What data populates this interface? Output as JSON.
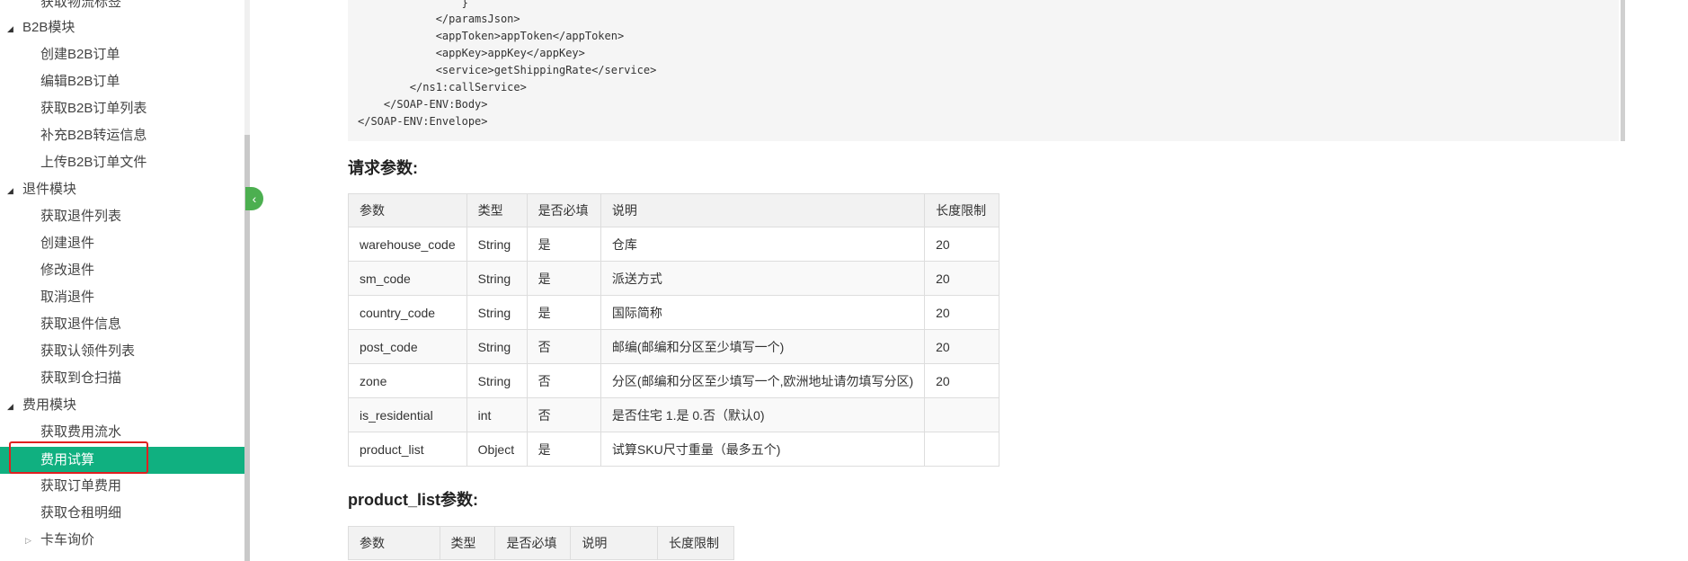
{
  "sidebar": {
    "truncated_top": "获取物流标签",
    "groups": {
      "b2b": {
        "label": "B2B模块",
        "items": [
          "创建B2B订单",
          "编辑B2B订单",
          "获取B2B订单列表",
          "补充B2B转运信息",
          "上传B2B订单文件"
        ]
      },
      "returns": {
        "label": "退件模块",
        "items": [
          "获取退件列表",
          "创建退件",
          "修改退件",
          "取消退件",
          "获取退件信息",
          "获取认领件列表",
          "获取到仓扫描"
        ]
      },
      "fees": {
        "label": "费用模块",
        "items": [
          "获取费用流水",
          "费用试算",
          "获取订单费用",
          "获取仓租明细",
          "卡车询价"
        ]
      }
    },
    "active_item": "费用试算"
  },
  "code": {
    "lines": [
      "                }",
      "            </paramsJson>",
      "            <appToken>appToken</appToken>",
      "            <appKey>appKey</appKey>",
      "            <service>getShippingRate</service>",
      "        </ns1:callService>",
      "    </SOAP-ENV:Body>",
      "</SOAP-ENV:Envelope>"
    ]
  },
  "request_params": {
    "title": "请求参数:",
    "headers": [
      "参数",
      "类型",
      "是否必填",
      "说明",
      "长度限制"
    ],
    "rows": [
      [
        "warehouse_code",
        "String",
        "是",
        "仓库",
        "20"
      ],
      [
        "sm_code",
        "String",
        "是",
        "派送方式",
        "20"
      ],
      [
        "country_code",
        "String",
        "是",
        "国际简称",
        "20"
      ],
      [
        "post_code",
        "String",
        "否",
        "邮编(邮编和分区至少填写一个)",
        "20"
      ],
      [
        "zone",
        "String",
        "否",
        "分区(邮编和分区至少填写一个,欧洲地址请勿填写分区)",
        "20"
      ],
      [
        "is_residential",
        "int",
        "否",
        "是否住宅 1.是 0.否（默认0)",
        ""
      ],
      [
        "product_list",
        "Object",
        "是",
        "试算SKU尺寸重量（最多五个)",
        ""
      ]
    ]
  },
  "product_list_params": {
    "title": "product_list参数:",
    "headers": [
      "参数",
      "类型",
      "是否必填",
      "说明",
      "长度限制"
    ]
  },
  "colors": {
    "active_bg": "#10b080",
    "highlight_border": "#e02020",
    "collapse_button": "#4caf50"
  },
  "icons": {
    "collapse": "chevron-left-icon",
    "expanded": "triangle-down-icon",
    "collapsed": "triangle-right-icon"
  }
}
